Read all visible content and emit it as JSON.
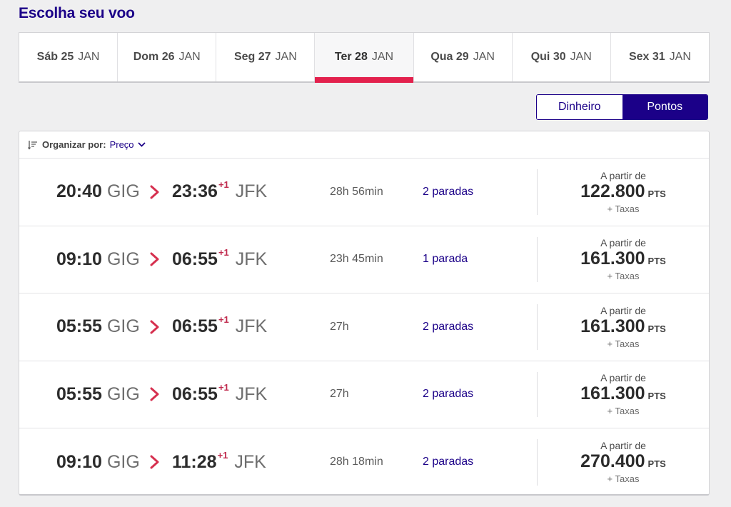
{
  "page": {
    "title": "Escolha seu voo"
  },
  "dates": [
    {
      "day": "Sáb 25",
      "month": "JAN"
    },
    {
      "day": "Dom 26",
      "month": "JAN"
    },
    {
      "day": "Seg 27",
      "month": "JAN"
    },
    {
      "day": "Ter 28",
      "month": "JAN"
    },
    {
      "day": "Qua 29",
      "month": "JAN"
    },
    {
      "day": "Qui 30",
      "month": "JAN"
    },
    {
      "day": "Sex 31",
      "month": "JAN"
    }
  ],
  "selected_date_index": 3,
  "currency_toggle": {
    "money": "Dinheiro",
    "points": "Pontos",
    "selected": "Pontos"
  },
  "sort": {
    "label": "Organizar por:",
    "value": "Preço"
  },
  "flights": [
    {
      "dep_time": "20:40",
      "dep_airport": "GIG",
      "arr_time": "23:36",
      "arr_offset": "+1",
      "arr_airport": "JFK",
      "duration": "28h 56min",
      "stops": "2 paradas",
      "price_from": "A partir de",
      "price": "122.800",
      "unit": "PTS",
      "taxes": "+ Taxas"
    },
    {
      "dep_time": "09:10",
      "dep_airport": "GIG",
      "arr_time": "06:55",
      "arr_offset": "+1",
      "arr_airport": "JFK",
      "duration": "23h 45min",
      "stops": "1 parada",
      "price_from": "A partir de",
      "price": "161.300",
      "unit": "PTS",
      "taxes": "+ Taxas"
    },
    {
      "dep_time": "05:55",
      "dep_airport": "GIG",
      "arr_time": "06:55",
      "arr_offset": "+1",
      "arr_airport": "JFK",
      "duration": "27h",
      "stops": "2 paradas",
      "price_from": "A partir de",
      "price": "161.300",
      "unit": "PTS",
      "taxes": "+ Taxas"
    },
    {
      "dep_time": "05:55",
      "dep_airport": "GIG",
      "arr_time": "06:55",
      "arr_offset": "+1",
      "arr_airport": "JFK",
      "duration": "27h",
      "stops": "2 paradas",
      "price_from": "A partir de",
      "price": "161.300",
      "unit": "PTS",
      "taxes": "+ Taxas"
    },
    {
      "dep_time": "09:10",
      "dep_airport": "GIG",
      "arr_time": "11:28",
      "arr_offset": "+1",
      "arr_airport": "JFK",
      "duration": "28h 18min",
      "stops": "2 paradas",
      "price_from": "A partir de",
      "price": "270.400",
      "unit": "PTS",
      "taxes": "+ Taxas"
    }
  ],
  "colors": {
    "brand": "#1b0088",
    "accent": "#e3214d",
    "background": "#efeff0"
  },
  "icons": {
    "sort": "sort-lines-icon",
    "sort_caret": "chevron-down-icon",
    "route_arrow": "chevron-right-icon"
  }
}
